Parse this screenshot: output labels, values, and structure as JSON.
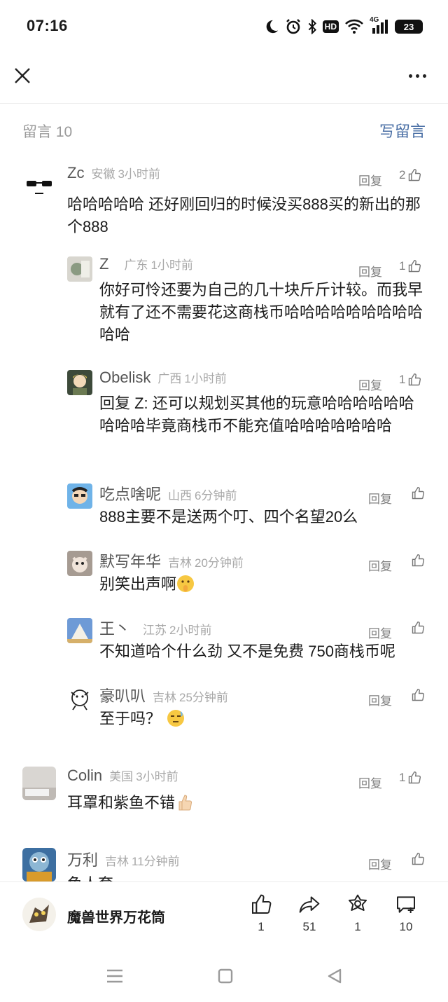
{
  "status_bar": {
    "time": "07:16",
    "hd_label": "HD",
    "network_label": "4G",
    "battery_level": "23"
  },
  "header": {
    "close_icon": "close-icon",
    "more_icon": "more-icon"
  },
  "comments_header": {
    "count_label": "留言 10",
    "write_label": "写留言"
  },
  "comments": [
    {
      "name": "Zc",
      "location": "安徽",
      "time": "3小时前",
      "reply_label": "回复",
      "likes": "2",
      "text": "哈哈哈哈哈 还好刚回归的时候没买888买的新出的那个888",
      "replies": [
        {
          "name": "Z",
          "location": "广东",
          "time": "1小时前",
          "reply_label": "回复",
          "likes": "1",
          "text": "你好可怜还要为自己的几十块斤斤计较。而我早就有了还不需要花这商栈币哈哈哈哈哈哈哈哈哈哈哈"
        },
        {
          "name": "Obelisk",
          "location": "广西",
          "time": "1小时前",
          "reply_label": "回复",
          "likes": "1",
          "text": "回复 Z: 还可以规划买其他的玩意哈哈哈哈哈哈哈哈哈毕竟商栈币不能充值哈哈哈哈哈哈哈"
        },
        {
          "name": "吃点啥呢",
          "location": "山西",
          "time": "6分钟前",
          "reply_label": "回复",
          "likes": "",
          "text": "888主要不是送两个叮、四个名望20么"
        },
        {
          "name": "默写年华",
          "location": "吉林",
          "time": "20分钟前",
          "reply_label": "回复",
          "likes": "",
          "text": "别笑出声啊"
        },
        {
          "name": "王丶",
          "location": "江苏",
          "time": "2小时前",
          "reply_label": "回复",
          "likes": "",
          "text": "不知道哈个什么劲 又不是免费 750商栈币呢"
        },
        {
          "name": "豪叭叭",
          "location": "吉林",
          "time": "25分钟前",
          "reply_label": "回复",
          "likes": "",
          "text": "至于吗？"
        }
      ]
    },
    {
      "name": "Colin",
      "location": "美国",
      "time": "3小时前",
      "reply_label": "回复",
      "likes": "1",
      "text": "耳罩和紫鱼不错"
    },
    {
      "name": "万利",
      "location": "吉林",
      "time": "11分钟前",
      "reply_label": "回复",
      "likes": "",
      "text": "鱼人套"
    }
  ],
  "bottom_bar": {
    "account_name": "魔兽世界万花筒",
    "like_count": "1",
    "share_count": "51",
    "wow_count": "1",
    "comment_count": "10"
  },
  "colors": {
    "accent_link": "#4a6fa5",
    "secondary_text": "#a8a8a8",
    "divider": "#ececec"
  }
}
